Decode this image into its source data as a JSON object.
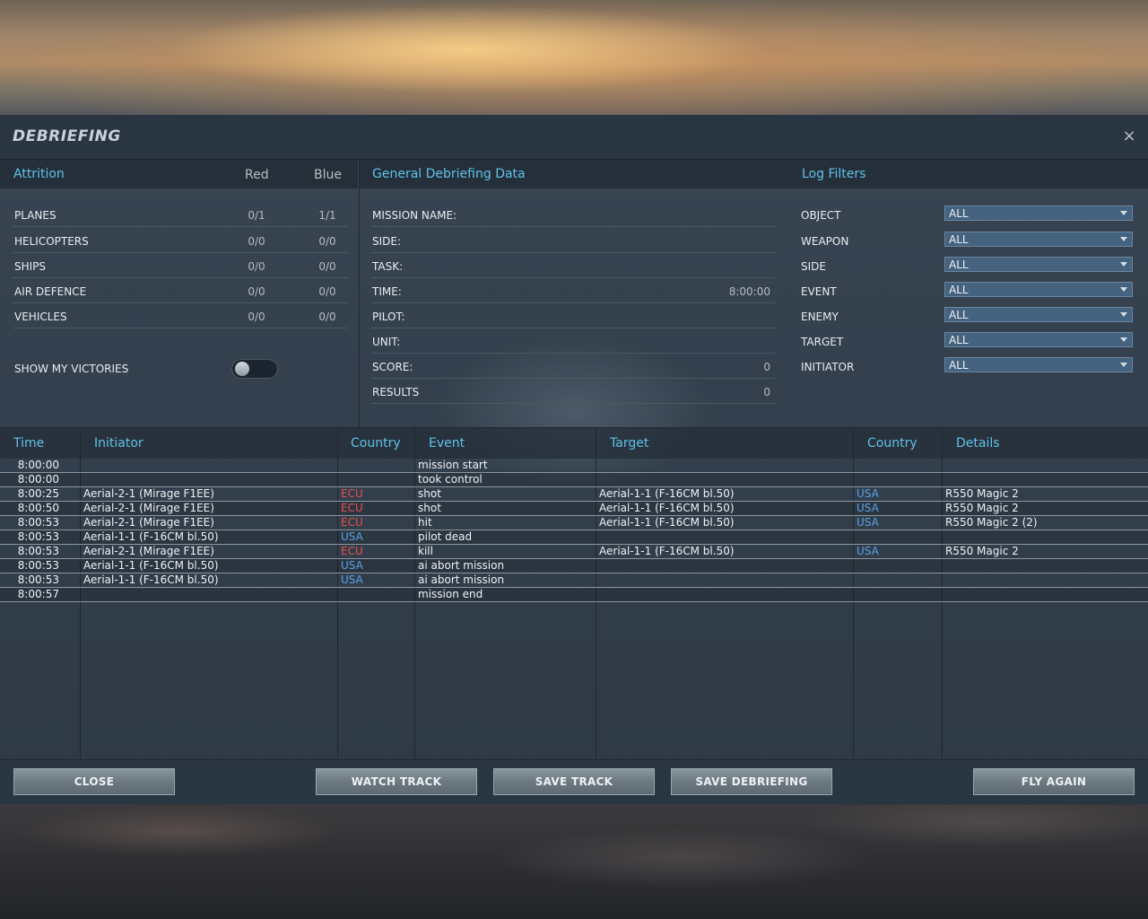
{
  "title": "DEBRIEFING",
  "close_glyph": "×",
  "attrition": {
    "heading": "Attrition",
    "col_red": "Red",
    "col_blue": "Blue",
    "rows": [
      {
        "label": "PLANES",
        "red": "0/1",
        "blue": "1/1"
      },
      {
        "label": "HELICOPTERS",
        "red": "0/0",
        "blue": "0/0"
      },
      {
        "label": "SHIPS",
        "red": "0/0",
        "blue": "0/0"
      },
      {
        "label": "AIR DEFENCE",
        "red": "0/0",
        "blue": "0/0"
      },
      {
        "label": "VEHICLES",
        "red": "0/0",
        "blue": "0/0"
      }
    ],
    "show_victories_label": "SHOW MY VICTORIES",
    "show_victories_on": false
  },
  "general": {
    "heading": "General Debriefing Data",
    "rows": [
      {
        "label": "MISSION NAME:",
        "value": ""
      },
      {
        "label": "SIDE:",
        "value": ""
      },
      {
        "label": "TASK:",
        "value": ""
      },
      {
        "label": "TIME:",
        "value": "8:00:00"
      },
      {
        "label": "PILOT:",
        "value": ""
      },
      {
        "label": "UNIT:",
        "value": ""
      },
      {
        "label": "SCORE:",
        "value": "0"
      },
      {
        "label": "RESULTS",
        "value": "0"
      }
    ]
  },
  "filters": {
    "heading": "Log Filters",
    "rows": [
      {
        "label": "OBJECT",
        "value": "ALL"
      },
      {
        "label": "WEAPON",
        "value": "ALL"
      },
      {
        "label": "SIDE",
        "value": "ALL"
      },
      {
        "label": "EVENT",
        "value": "ALL"
      },
      {
        "label": "ENEMY",
        "value": "ALL"
      },
      {
        "label": "TARGET",
        "value": "ALL"
      },
      {
        "label": "INITIATOR",
        "value": "ALL"
      }
    ]
  },
  "log": {
    "headers": {
      "time": "Time",
      "initiator": "Initiator",
      "country": "Country",
      "event": "Event",
      "target": "Target",
      "target_country": "Country",
      "details": "Details"
    },
    "rows": [
      {
        "time": "8:00:00",
        "initiator": "",
        "country": "",
        "event": "mission start",
        "target": "",
        "target_country": "",
        "details": ""
      },
      {
        "time": "8:00:00",
        "initiator": "",
        "country": "",
        "event": "took control",
        "target": "",
        "target_country": "",
        "details": ""
      },
      {
        "time": "8:00:25",
        "initiator": "Aerial-2-1 (Mirage F1EE)",
        "country": "ECU",
        "event": "shot",
        "target": "Aerial-1-1 (F-16CM bl.50)",
        "target_country": "USA",
        "details": "R550 Magic 2"
      },
      {
        "time": "8:00:50",
        "initiator": "Aerial-2-1 (Mirage F1EE)",
        "country": "ECU",
        "event": "shot",
        "target": "Aerial-1-1 (F-16CM bl.50)",
        "target_country": "USA",
        "details": "R550 Magic 2"
      },
      {
        "time": "8:00:53",
        "initiator": "Aerial-2-1 (Mirage F1EE)",
        "country": "ECU",
        "event": "hit",
        "target": "Aerial-1-1 (F-16CM bl.50)",
        "target_country": "USA",
        "details": "R550 Magic 2 (2)"
      },
      {
        "time": "8:00:53",
        "initiator": "Aerial-1-1 (F-16CM bl.50)",
        "country": "USA",
        "event": "pilot dead",
        "target": "",
        "target_country": "",
        "details": ""
      },
      {
        "time": "8:00:53",
        "initiator": "Aerial-2-1 (Mirage F1EE)",
        "country": "ECU",
        "event": "kill",
        "target": "Aerial-1-1 (F-16CM bl.50)",
        "target_country": "USA",
        "details": "R550 Magic 2"
      },
      {
        "time": "8:00:53",
        "initiator": "Aerial-1-1 (F-16CM bl.50)",
        "country": "USA",
        "event": "ai abort mission",
        "target": "",
        "target_country": "",
        "details": ""
      },
      {
        "time": "8:00:53",
        "initiator": "Aerial-1-1 (F-16CM bl.50)",
        "country": "USA",
        "event": "ai abort mission",
        "target": "",
        "target_country": "",
        "details": ""
      },
      {
        "time": "8:00:57",
        "initiator": "",
        "country": "",
        "event": "mission end",
        "target": "",
        "target_country": "",
        "details": ""
      }
    ]
  },
  "buttons": {
    "close": "CLOSE",
    "watch_track": "WATCH TRACK",
    "save_track": "SAVE TRACK",
    "save_debriefing": "SAVE DEBRIEFING",
    "fly_again": "FLY AGAIN"
  },
  "colors": {
    "accent": "#5fc2e8",
    "red_country": "#e8504a",
    "blue_country": "#5aa2e8"
  }
}
